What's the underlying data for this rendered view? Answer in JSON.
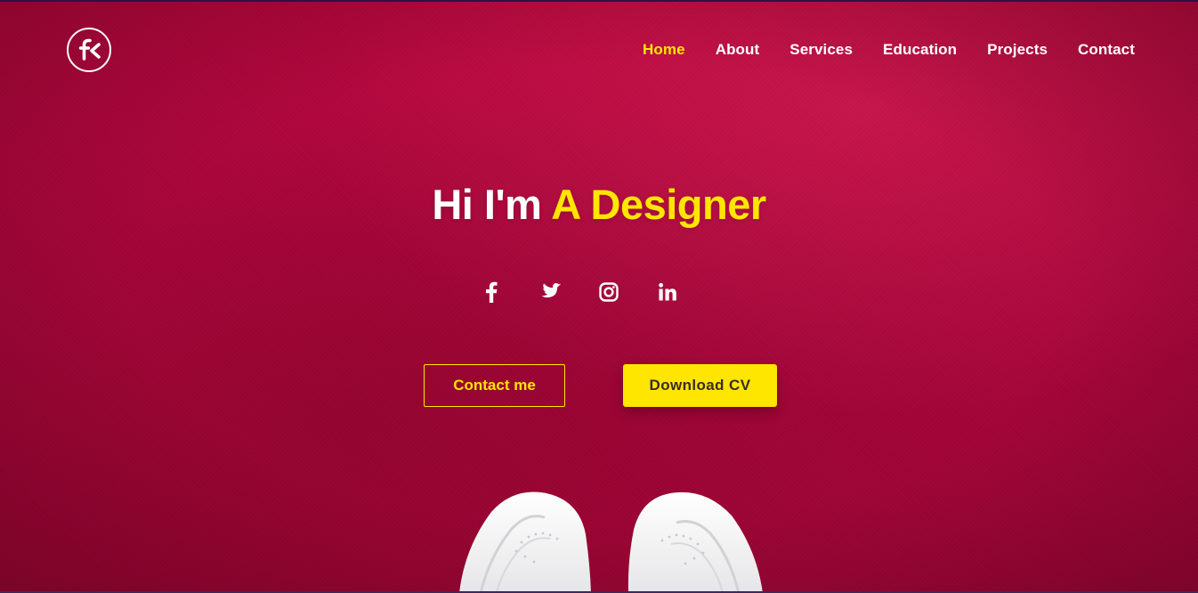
{
  "header": {
    "logo_text": "fk",
    "nav": [
      {
        "label": "Home",
        "active": true
      },
      {
        "label": "About",
        "active": false
      },
      {
        "label": "Services",
        "active": false
      },
      {
        "label": "Education",
        "active": false
      },
      {
        "label": "Projects",
        "active": false
      },
      {
        "label": "Contact",
        "active": false
      }
    ]
  },
  "hero": {
    "headline_prefix": "Hi I'm",
    "headline_accent": "A Designer",
    "social_icons": [
      "facebook-icon",
      "twitter-icon",
      "instagram-icon",
      "linkedin-icon"
    ],
    "contact_button": "Contact me",
    "download_button": "Download CV"
  },
  "colors": {
    "accent": "#ffe600",
    "background": "#b8063e",
    "text": "#ffffff"
  }
}
